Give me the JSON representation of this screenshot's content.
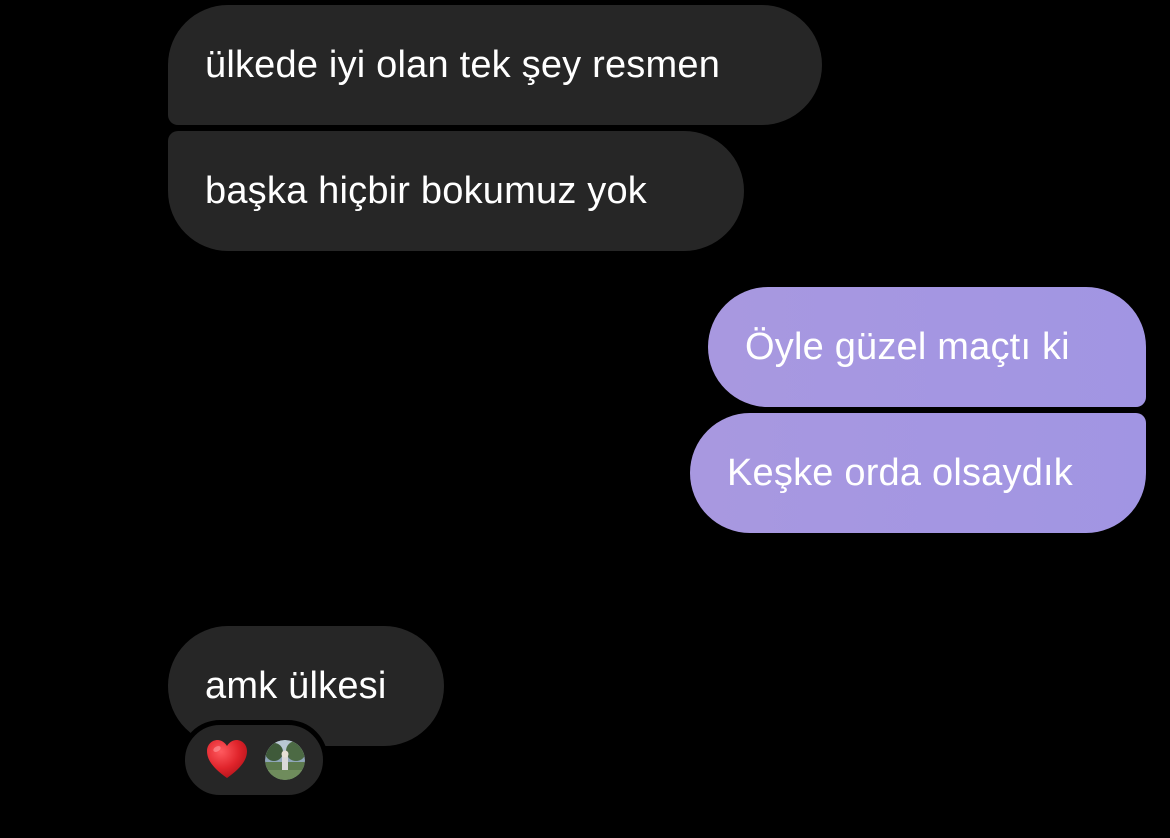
{
  "messages": [
    {
      "id": "b1",
      "direction": "incoming",
      "text": "ülkede iyi olan tek şey resmen"
    },
    {
      "id": "b2",
      "direction": "incoming",
      "text": "başka hiçbir bokumuz yok"
    },
    {
      "id": "b3",
      "direction": "outgoing",
      "text": "Öyle güzel maçtı ki"
    },
    {
      "id": "b4",
      "direction": "outgoing",
      "text": "Keşke orda olsaydık"
    },
    {
      "id": "b5",
      "direction": "incoming",
      "text": "amk ülkesi"
    }
  ],
  "reaction": {
    "emoji_icon": "red-heart-icon",
    "reactor_icon": "avatar"
  },
  "colors": {
    "background": "#000000",
    "incoming_bubble": "#262626",
    "outgoing_bubble": "#a59ae2",
    "heart": "#e0242b"
  }
}
